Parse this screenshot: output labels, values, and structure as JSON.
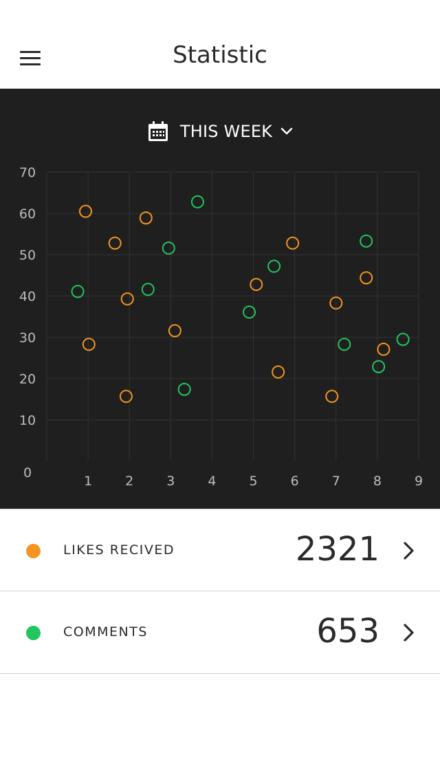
{
  "header": {
    "title": "Statistic",
    "menu_icon": "hamburger-menu-icon"
  },
  "period": {
    "label": "THIS WEEK",
    "icon": "calendar-icon",
    "dropdown_icon": "chevron-down-icon"
  },
  "colors": {
    "likes": "#f5951f",
    "comments": "#22c55e",
    "panel": "#1f1f1f",
    "grid": "#333333",
    "tick": "#bdbdbd"
  },
  "chart_data": {
    "type": "scatter",
    "xlim": [
      0,
      9
    ],
    "ylim": [
      0,
      70
    ],
    "xticks": [
      "1",
      "2",
      "3",
      "4",
      "5",
      "6",
      "7",
      "8",
      "9"
    ],
    "yticks": [
      "0",
      "10",
      "20",
      "30",
      "40",
      "50",
      "60",
      "70"
    ],
    "grid": true,
    "series": [
      {
        "key": "likes",
        "points": [
          [
            0.94,
            60.5
          ],
          [
            1.65,
            52.8
          ],
          [
            1.02,
            28.3
          ],
          [
            1.95,
            39.3
          ],
          [
            1.92,
            15.7
          ],
          [
            2.4,
            58.9
          ],
          [
            3.1,
            31.6
          ],
          [
            5.07,
            42.8
          ],
          [
            5.95,
            52.8
          ],
          [
            5.6,
            21.6
          ],
          [
            7.0,
            38.3
          ],
          [
            6.9,
            15.7
          ],
          [
            7.73,
            44.4
          ],
          [
            8.15,
            27.1
          ]
        ]
      },
      {
        "key": "comments",
        "points": [
          [
            0.75,
            41.1
          ],
          [
            2.45,
            41.6
          ],
          [
            2.95,
            51.6
          ],
          [
            3.65,
            62.8
          ],
          [
            3.33,
            17.4
          ],
          [
            4.9,
            36.1
          ],
          [
            5.5,
            47.2
          ],
          [
            7.2,
            28.3
          ],
          [
            7.73,
            53.3
          ],
          [
            8.03,
            22.9
          ],
          [
            8.62,
            29.5
          ]
        ]
      }
    ]
  },
  "stats": [
    {
      "key": "likes",
      "label": "LIKES RECIVED",
      "value": "2321"
    },
    {
      "key": "comments",
      "label": "COMMENTS",
      "value": "653"
    }
  ]
}
